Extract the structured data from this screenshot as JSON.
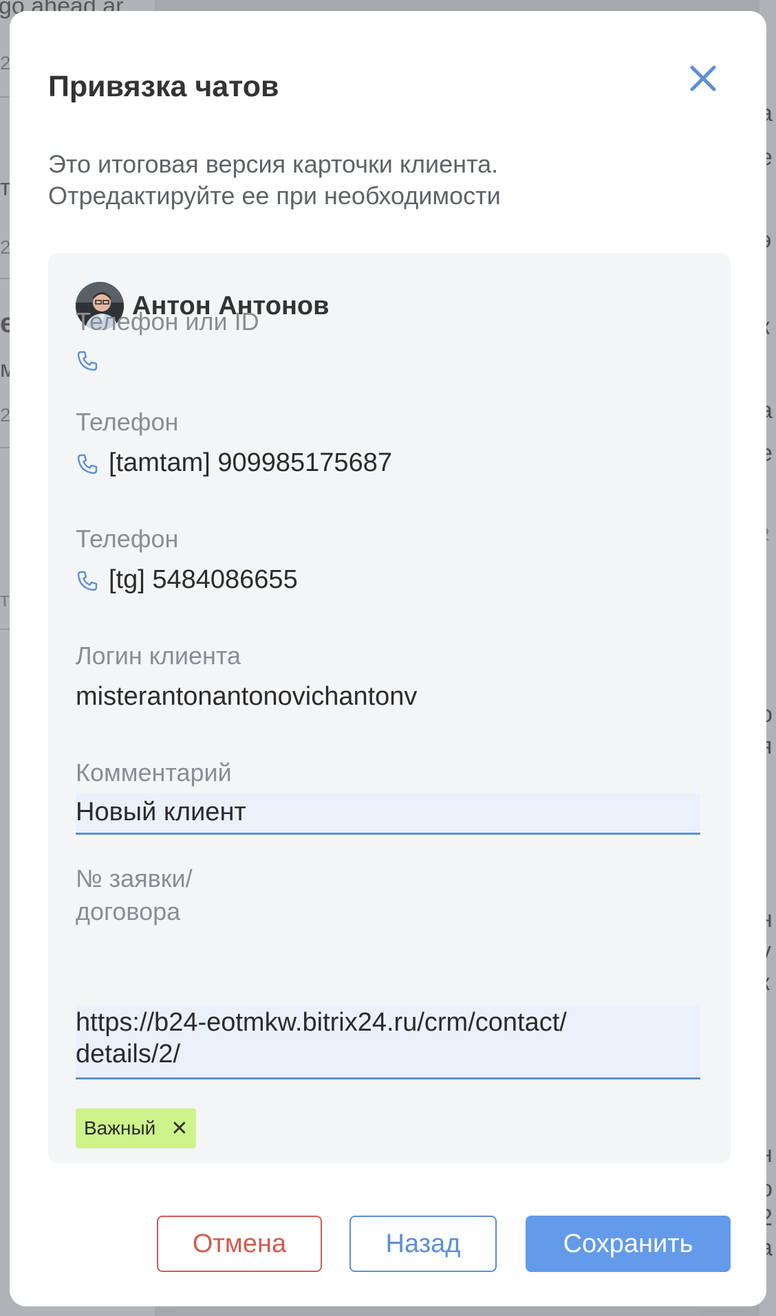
{
  "background": {
    "left_fragments": [
      "go ahead ar",
      "27",
      "т",
      "27",
      "е",
      "мс",
      "2",
      "т"
    ],
    "right_fragments": [
      "а",
      "е",
      "-",
      "э",
      "к",
      "а",
      "е",
      "2",
      "о",
      "я",
      "н",
      "v",
      "к",
      "н",
      "о",
      "2",
      "a"
    ]
  },
  "modal": {
    "title": "Привязка чатов",
    "subtitle_line1": "Это итоговая версия карточки клиента.",
    "subtitle_line2": "Отредактируйте ее при необходимости"
  },
  "card": {
    "name": "Антон Антонов",
    "fields": {
      "phone_or_id_label": "Телефон или ID",
      "phone1_label": "Телефон",
      "phone1_value": "[tamtam] 909985175687",
      "phone2_label": "Телефон",
      "phone2_value": "[tg] 5484086655",
      "login_label": "Логин клиента",
      "login_value": "misterantonantonovichantonv",
      "comment_label": "Комментарий",
      "comment_value": "Новый клиент",
      "order_label_line1": "№ заявки/",
      "order_label_line2": "договора",
      "order_value_line1": "https://b24-eotmkw.bitrix24.ru/crm/contact/",
      "order_value_line2": "details/2/"
    },
    "tag": {
      "label": "Важный",
      "remove": "✕"
    }
  },
  "buttons": {
    "cancel": "Отмена",
    "back": "Назад",
    "save": "Сохранить"
  },
  "colors": {
    "accent": "#639aea",
    "danger": "#d45a4f",
    "tag_bg": "#cdf38a",
    "card_bg": "#f4f5f7"
  },
  "icons": [
    "close-icon",
    "phone-icon",
    "avatar",
    "tag-remove-icon"
  ]
}
